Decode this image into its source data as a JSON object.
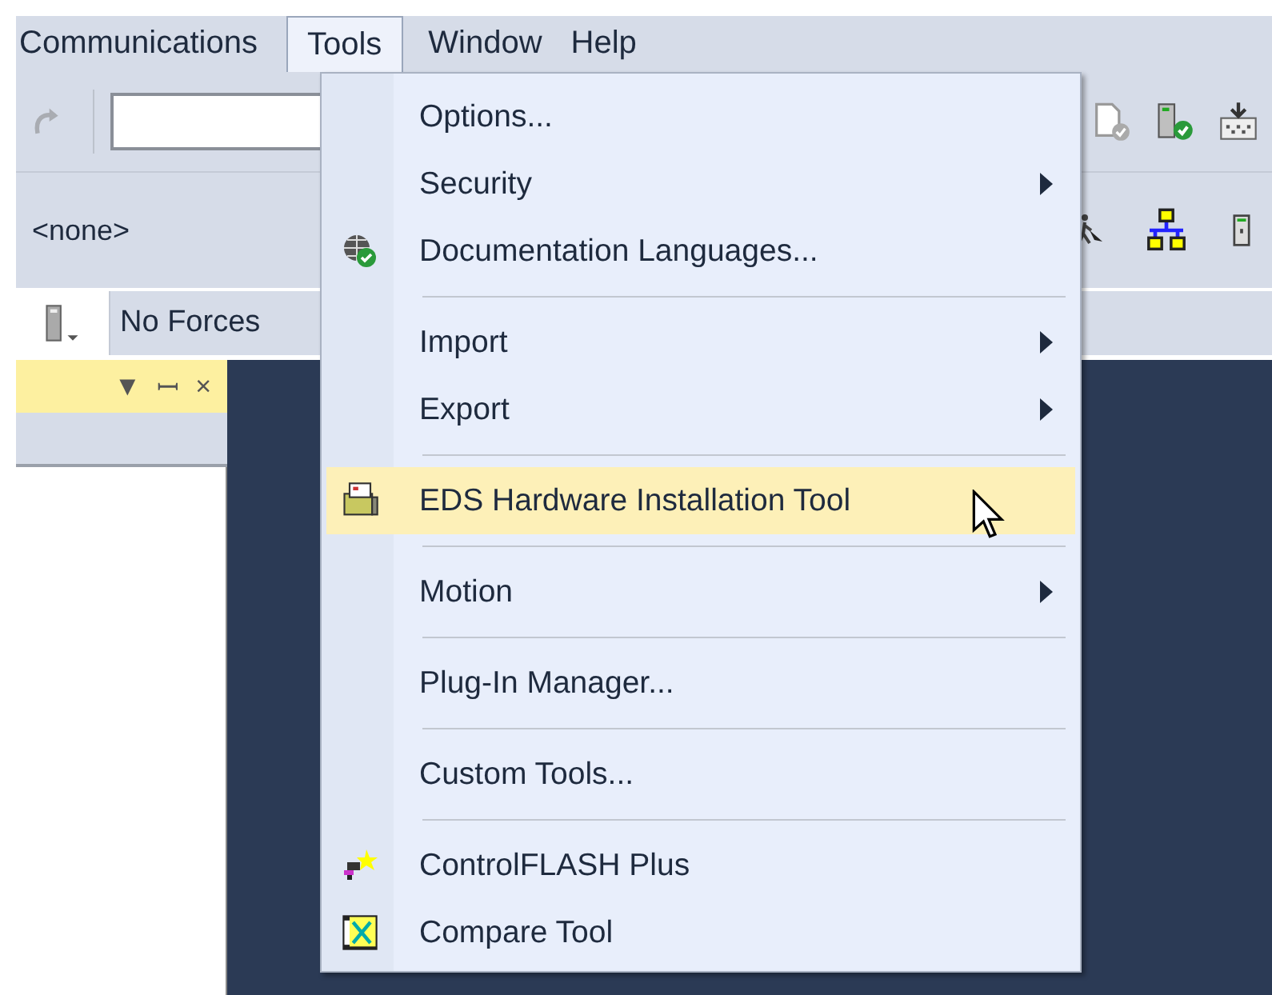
{
  "menubar": [
    {
      "label": "Communications",
      "selected": false
    },
    {
      "label": "Tools",
      "selected": true
    },
    {
      "label": "Window",
      "selected": false
    },
    {
      "label": "Help",
      "selected": false
    }
  ],
  "routine_selector": {
    "value": "<none>"
  },
  "forces": {
    "label": "No Forces"
  },
  "panel": {
    "buttons": [
      "▼",
      "ꟷ",
      "×"
    ]
  },
  "tools_menu": {
    "items": [
      {
        "kind": "item",
        "label": "Options...",
        "submenu": false,
        "selected": false
      },
      {
        "kind": "item",
        "label": "Security",
        "submenu": true,
        "selected": false
      },
      {
        "kind": "item",
        "label": "Documentation Languages...",
        "submenu": false,
        "selected": false
      },
      {
        "kind": "separator"
      },
      {
        "kind": "item",
        "label": "Import",
        "submenu": true,
        "selected": false
      },
      {
        "kind": "item",
        "label": "Export",
        "submenu": true,
        "selected": false
      },
      {
        "kind": "separator"
      },
      {
        "kind": "item",
        "label": "EDS Hardware Installation Tool",
        "submenu": false,
        "selected": true
      },
      {
        "kind": "separator"
      },
      {
        "kind": "item",
        "label": "Motion",
        "submenu": true,
        "selected": false
      },
      {
        "kind": "separator"
      },
      {
        "kind": "item",
        "label": "Plug-In Manager...",
        "submenu": false,
        "selected": false
      },
      {
        "kind": "separator"
      },
      {
        "kind": "item",
        "label": "Custom Tools...",
        "submenu": false,
        "selected": false
      },
      {
        "kind": "separator"
      },
      {
        "kind": "item",
        "label": "ControlFLASH Plus",
        "submenu": false,
        "selected": false
      },
      {
        "kind": "item",
        "label": "Compare Tool",
        "submenu": false,
        "selected": false
      }
    ]
  }
}
